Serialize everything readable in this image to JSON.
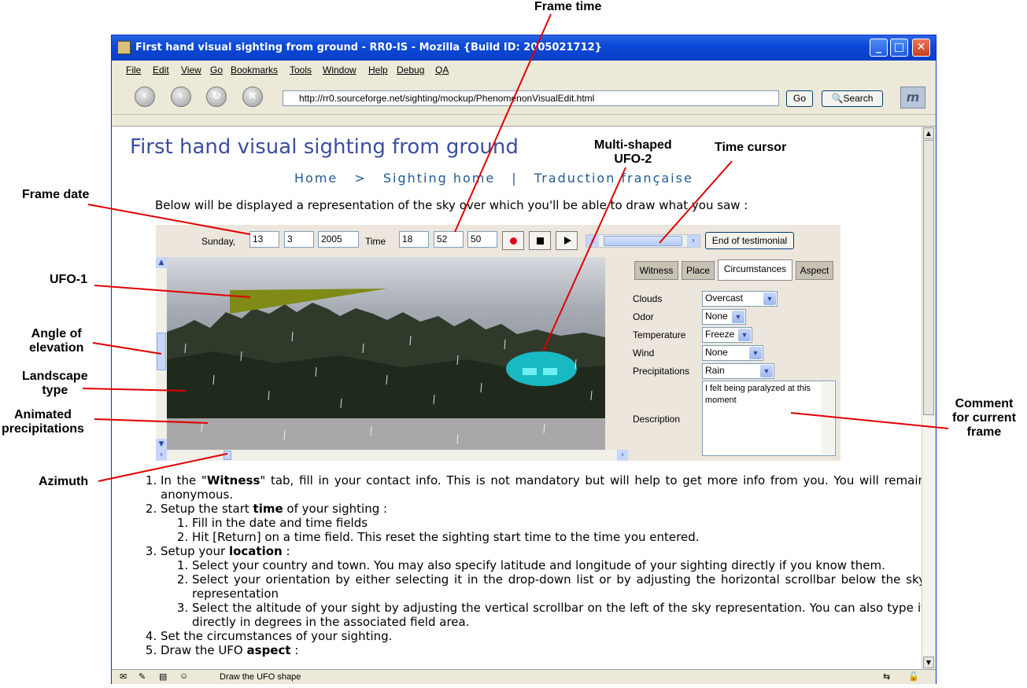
{
  "annotations": {
    "frame_time": "Frame time",
    "multi_shaped_ufo_2_line1": "Multi-shaped",
    "multi_shaped_ufo_2_line2": "UFO-2",
    "time_cursor": "Time cursor",
    "frame_date": "Frame date",
    "ufo_1": "UFO-1",
    "angle_of_elevation_line1": "Angle of",
    "angle_of_elevation_line2": "elevation",
    "landscape_type_line1": "Landscape",
    "landscape_type_line2": "type",
    "animated_precipitations_line1": "Animated",
    "animated_precipitations_line2": "precipitations",
    "azimuth": "Azimuth",
    "comment_line1": "Comment",
    "comment_line2": "for current",
    "comment_line3": "frame"
  },
  "window": {
    "title": "First hand visual sighting from ground - RR0-IS - Mozilla {Build ID: 2005021712}"
  },
  "menu": [
    "File",
    "Edit",
    "View",
    "Go",
    "Bookmarks",
    "Tools",
    "Window",
    "Help",
    "Debug",
    "QA"
  ],
  "toolbar": {
    "url": "http://rr0.sourceforge.net/sighting/mockup/PhenomenonVisualEdit.html",
    "go_label": "Go",
    "search_label": "Search"
  },
  "page": {
    "title": "First hand visual sighting from ground",
    "breadcrumb": {
      "home": "Home",
      "separator1": ">",
      "sighting_home": "Sighting home",
      "separator2": "|",
      "french": "Traduction française"
    },
    "intro": "Below will be displayed a representation of the sky over which you'll be able to draw what you saw :"
  },
  "frame": {
    "day_name": "Sunday,",
    "day": "13",
    "month": "3",
    "year": "2005",
    "time_label": "Time",
    "hour": "18",
    "minute": "52",
    "second": "50",
    "time_cursor_position": 0.4,
    "end_button": "End of testimonial"
  },
  "tabs": [
    "Witness",
    "Place",
    "Circumstances",
    "Aspect"
  ],
  "active_tab": "Circumstances",
  "circumstances": {
    "clouds_label": "Clouds",
    "clouds_value": "Overcast",
    "odor_label": "Odor",
    "odor_value": "None",
    "temperature_label": "Temperature",
    "temperature_value": "Freeze",
    "wind_label": "Wind",
    "wind_value": "None",
    "precipitations_label": "Precipitations",
    "precipitations_value": "Rain",
    "description_label": "Description",
    "description_value": "I felt being paralyzed at this moment"
  },
  "instructions": {
    "s1_pre": "In the \"",
    "s1_bold": "Witness",
    "s1_post": "\" tab, fill in your contact info. This is not mandatory but will help to get more info from you. You will remain anonymous.",
    "s2_pre": "Setup the start ",
    "s2_bold": "time",
    "s2_post": " of your sighting :",
    "s2_1": "Fill in the date and time fields",
    "s2_2": "Hit [Return] on a time field. This reset the sighting start time to the time you entered.",
    "s3_pre": "Setup your ",
    "s3_bold": "location",
    "s3_post": " :",
    "s3_1": "Select your country and town. You may also specify latitude and longitude of your sighting directly if you know them.",
    "s3_2": "Select your orientation by either selecting it in the drop-down list or by adjusting the horizontal scrollbar below the sky representation",
    "s3_3": "Select the altitude of your sight by adjusting the vertical scrollbar on the left of the sky representation. You can also type it directly in degrees in the associated field area.",
    "s4": "Set the circumstances of your sighting.",
    "s5_pre": "Draw the UFO ",
    "s5_bold": "aspect",
    "s5_post": " :"
  },
  "status": {
    "text": "Draw the UFO shape"
  },
  "colors": {
    "title_blue": "#3b4ea0",
    "link_blue": "#1f5a92",
    "ufo1": "#7f8a17",
    "ufo2": "#19b9c4",
    "annotation_line": "#e00000"
  }
}
